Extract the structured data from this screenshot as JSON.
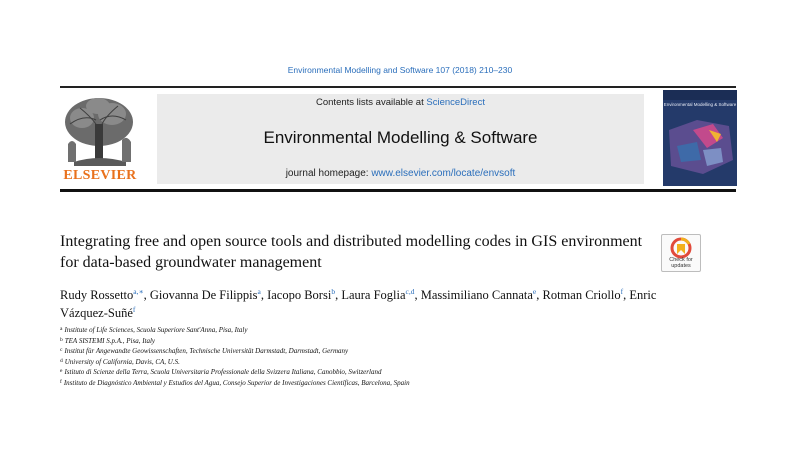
{
  "citation": "Environmental Modelling and Software 107 (2018) 210–230",
  "header": {
    "contents_prefix": "Contents lists available at",
    "contents_link": "ScienceDirect",
    "journal_title": "Environmental Modelling & Software",
    "homepage_prefix": "journal homepage:",
    "homepage_url": "www.elsevier.com/locate/envsoft",
    "publisher": "ELSEVIER",
    "cover_title": "Environmental Modelling & Software"
  },
  "article": {
    "title": "Integrating free and open source tools and distributed modelling codes in GIS environment for data-based groundwater management",
    "check_updates_label": "Check for updates",
    "authors": [
      {
        "name": "Rudy Rossetto",
        "sup": "a,∗",
        "sep": ", "
      },
      {
        "name": "Giovanna De Filippis",
        "sup": "a",
        "sep": ", "
      },
      {
        "name": "Iacopo Borsi",
        "sup": "b",
        "sep": ", "
      },
      {
        "name": "Laura Foglia",
        "sup": "c,d",
        "sep": ", "
      },
      {
        "name": "Massimiliano Cannata",
        "sup": "e",
        "sep": ", "
      },
      {
        "name": "Rotman Criollo",
        "sup": "f",
        "sep": ", "
      },
      {
        "name": "Enric Vázquez-Suñé",
        "sup": "f",
        "sep": ""
      }
    ],
    "affiliations": [
      {
        "label": "a",
        "text": "Institute of Life Sciences, Scuola Superiore Sant'Anna, Pisa, Italy"
      },
      {
        "label": "b",
        "text": "TEA SISTEMI S.p.A., Pisa, Italy"
      },
      {
        "label": "c",
        "text": "Institut für Angewandte Geowissenschaften, Technische Universität Darmstadt, Darmstadt, Germany"
      },
      {
        "label": "d",
        "text": "University of California, Davis, CA, U.S."
      },
      {
        "label": "e",
        "text": "Istituto di Scienze della Terra, Scuola Universitaria Professionale della Svizzera Italiana, Canobbio, Switzerland"
      },
      {
        "label": "f",
        "text": "Instituto de Diagnóstico Ambiental y Estudios del Agua, Consejo Superior de Investigaciones Científicas, Barcelona, Spain"
      }
    ]
  },
  "colors": {
    "link": "#2a6ebb",
    "publisher_orange": "#e9711c",
    "banner_gray": "#ebebeb",
    "cover_blue": "#243a6a"
  }
}
